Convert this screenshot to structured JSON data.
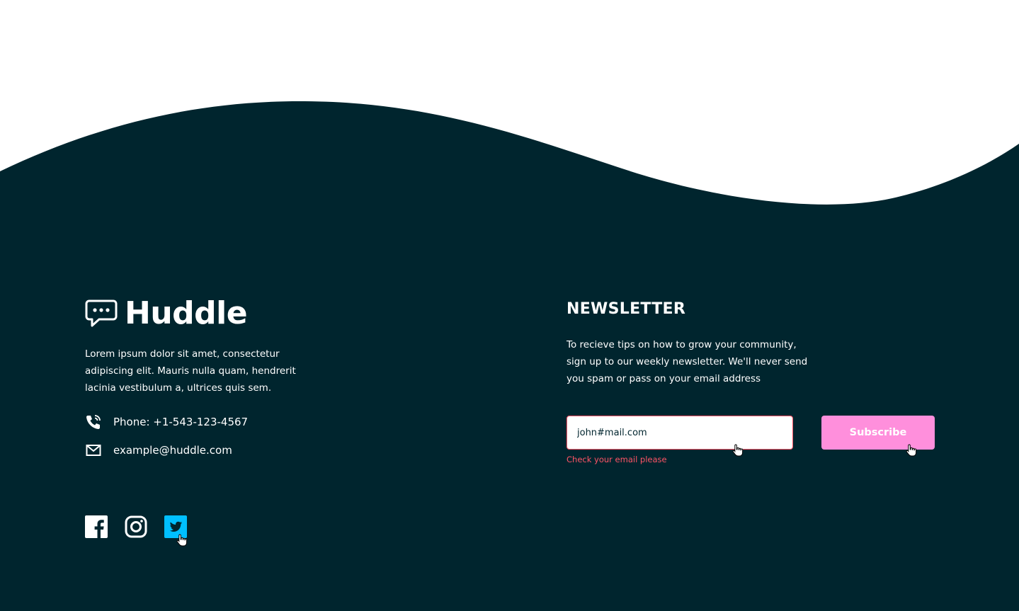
{
  "brand": {
    "name": "Huddle",
    "description": "Lorem ipsum dolor sit amet, consectetur adipiscing elit. Mauris nulla quam, hendrerit lacinia vestibulum a, ultrices quis sem."
  },
  "contact": {
    "phone": "Phone: +1-543-123-4567",
    "email": "example@huddle.com",
    "phone_icon": "phone-icon",
    "email_icon": "mail-icon"
  },
  "socials": [
    {
      "name": "facebook-icon",
      "state": "default"
    },
    {
      "name": "instagram-icon",
      "state": "default"
    },
    {
      "name": "twitter-icon",
      "state": "hover"
    }
  ],
  "newsletter": {
    "title": "NEWSLETTER",
    "text": "To recieve tips on how to grow your community, sign up to our weekly newsletter. We'll never send you spam or pass on your email address",
    "email_value": "john#mail.com",
    "error": "Check your email please",
    "subscribe_label": "Subscribe"
  },
  "colors": {
    "footer_bg": "#00252e",
    "error": "#ff5466",
    "button_pink": "#ff8fdc",
    "twitter_hover": "#00bfff"
  }
}
